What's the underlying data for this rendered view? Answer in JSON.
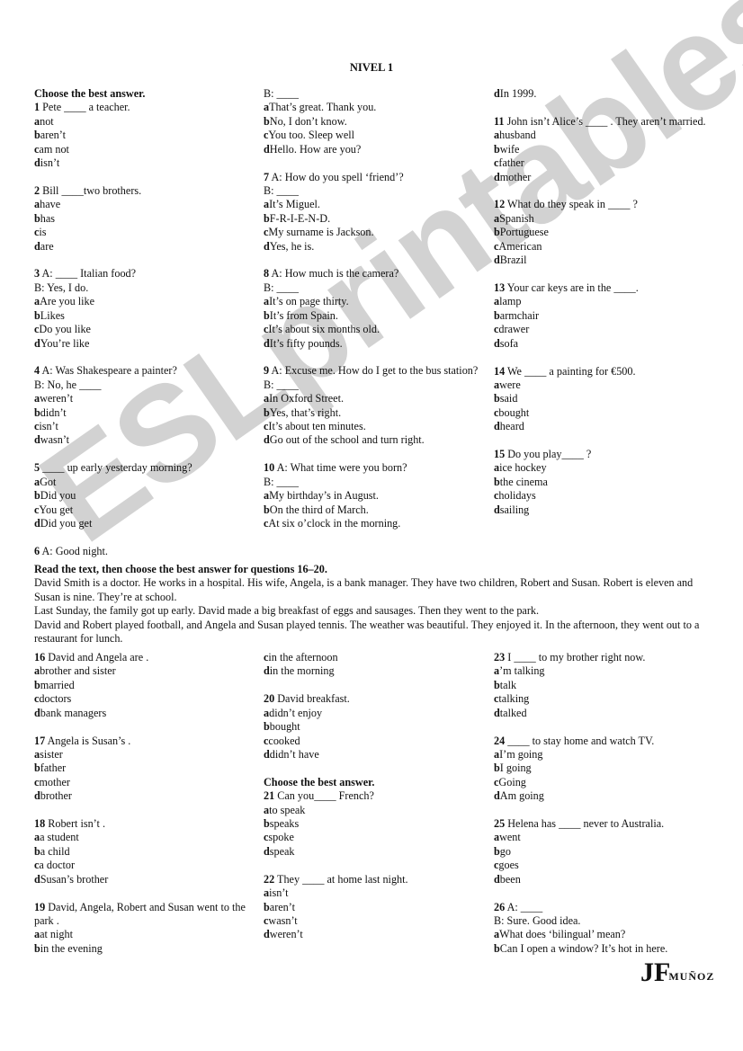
{
  "watermark": "ESLprintables.com",
  "title": "NIVEL 1",
  "section1_heading": "Choose the best answer.",
  "columns_top": [
    [
      {
        "n": "1",
        "stem": "Pete ____ a teacher.",
        "extra": [],
        "options": [
          [
            "a",
            "not"
          ],
          [
            "b",
            "aren’t"
          ],
          [
            "c",
            "am not"
          ],
          [
            "d",
            "isn’t"
          ]
        ]
      },
      {
        "n": "2",
        "stem": "Bill ____two brothers.",
        "extra": [],
        "options": [
          [
            "a",
            "have"
          ],
          [
            "b",
            "has"
          ],
          [
            "c",
            "is"
          ],
          [
            "d",
            "are"
          ]
        ]
      },
      {
        "n": "3",
        "stem": "A: ____  Italian food?",
        "extra": [
          "B: Yes, I do."
        ],
        "options": [
          [
            "a",
            "Are you like"
          ],
          [
            "b",
            "Likes"
          ],
          [
            "c",
            "Do you like"
          ],
          [
            "d",
            "You’re like"
          ]
        ]
      },
      {
        "n": "4",
        "stem": "A: Was Shakespeare a painter?",
        "extra": [
          "B: No, he ____"
        ],
        "options": [
          [
            "a",
            "weren’t"
          ],
          [
            "b",
            "didn’t"
          ],
          [
            "c",
            "isn’t"
          ],
          [
            "d",
            "wasn’t"
          ]
        ]
      },
      {
        "n": "5",
        "stem": "____ up early yesterday morning?",
        "extra": [],
        "options": [
          [
            "a",
            "Got"
          ],
          [
            "b",
            "Did you"
          ],
          [
            "c",
            "You get"
          ],
          [
            "d",
            "Did you get"
          ]
        ]
      },
      {
        "n": "6",
        "stem": "A: Good night.",
        "extra": [],
        "options": []
      }
    ],
    [
      {
        "n": "",
        "stem": "",
        "extra": [
          "B: ____"
        ],
        "options": [
          [
            "a",
            "That’s great. Thank you."
          ],
          [
            "b",
            "No, I don’t know."
          ],
          [
            "c",
            "You too. Sleep well"
          ],
          [
            "d",
            "Hello. How are you?"
          ]
        ]
      },
      {
        "n": "7",
        "stem": "A: How do you spell ‘friend’?",
        "extra": [
          "B: ____"
        ],
        "options": [
          [
            "a",
            "It’s Miguel."
          ],
          [
            "b",
            "F-R-I-E-N-D."
          ],
          [
            "c",
            "My surname is Jackson."
          ],
          [
            "d",
            "Yes, he is."
          ]
        ]
      },
      {
        "n": "8",
        "stem": "A: How much is the camera?",
        "extra": [
          "B: ____"
        ],
        "options": [
          [
            "a",
            "It’s on page thirty."
          ],
          [
            "b",
            "It’s from Spain."
          ],
          [
            "c",
            "It’s about six months old."
          ],
          [
            "d",
            "It’s fifty pounds."
          ]
        ]
      },
      {
        "n": "9",
        "stem": "A: Excuse me. How do I get to the bus station?",
        "extra": [
          "B: ____"
        ],
        "options": [
          [
            "a",
            "In Oxford Street."
          ],
          [
            "b",
            "Yes, that’s right."
          ],
          [
            "c",
            "It’s about ten minutes."
          ],
          [
            "d",
            "Go out of the school and turn right."
          ]
        ]
      },
      {
        "n": "10",
        "stem": "A: What time were you born?",
        "extra": [
          "B: ____"
        ],
        "options": [
          [
            "a",
            "My birthday’s in August."
          ],
          [
            "b",
            "On the third of March."
          ],
          [
            "c",
            "At six o’clock in the morning."
          ]
        ]
      }
    ],
    [
      {
        "n": "",
        "stem": "",
        "extra": [],
        "options": [
          [
            "d",
            "In 1999."
          ]
        ]
      },
      {
        "n": "11",
        "stem": "John isn’t Alice’s ____ . They aren’t married.",
        "extra": [],
        "options": [
          [
            "a",
            "husband"
          ],
          [
            "b",
            "wife"
          ],
          [
            "c",
            "father"
          ],
          [
            "d",
            "mother"
          ]
        ]
      },
      {
        "n": "12",
        "stem": "What do they speak in ____ ?",
        "extra": [],
        "options": [
          [
            "a",
            "Spanish"
          ],
          [
            "b",
            "Portuguese"
          ],
          [
            "c",
            "American"
          ],
          [
            "d",
            "Brazil"
          ]
        ]
      },
      {
        "n": "13",
        "stem": "Your car keys are in the ____.",
        "extra": [],
        "options": [
          [
            "a",
            "lamp"
          ],
          [
            "b",
            "armchair"
          ],
          [
            "c",
            "drawer"
          ],
          [
            "d",
            "sofa"
          ]
        ]
      },
      {
        "n": "14",
        "stem": "We ____ a painting for €500.",
        "extra": [],
        "options": [
          [
            "a",
            "were"
          ],
          [
            "b",
            "said"
          ],
          [
            "c",
            "bought"
          ],
          [
            "d",
            "heard"
          ]
        ]
      },
      {
        "n": "15",
        "stem": "Do you play____ ?",
        "extra": [],
        "options": [
          [
            "a",
            "ice hockey"
          ],
          [
            "b",
            "the cinema"
          ],
          [
            "c",
            "holidays"
          ],
          [
            "d",
            "sailing"
          ]
        ]
      }
    ]
  ],
  "reading": {
    "heading": "Read the text, then choose the best answer for questions 16–20.",
    "paragraphs": [
      "David Smith is a doctor. He works in a hospital. His wife, Angela, is a bank manager. They have two children, Robert and Susan. Robert is eleven and Susan is nine. They’re at school.",
      "Last Sunday, the family got up early. David made a big breakfast of eggs and sausages. Then they went to the park.",
      "David and Robert played football, and Angela and Susan played tennis.  The weather was beautiful.  They enjoyed it.  In the afternoon, they went out to a restaurant for lunch."
    ]
  },
  "section2_heading": "Choose the best answer.",
  "columns_bottom": [
    [
      {
        "n": "16",
        "stem": "David and Angela are .",
        "extra": [],
        "options": [
          [
            "a",
            "brother and sister"
          ],
          [
            "b",
            "married"
          ],
          [
            "c",
            "doctors"
          ],
          [
            "d",
            "bank managers"
          ]
        ]
      },
      {
        "n": "17",
        "stem": "Angela is Susan’s .",
        "extra": [],
        "options": [
          [
            "a",
            "sister"
          ],
          [
            "b",
            "father"
          ],
          [
            "c",
            "mother"
          ],
          [
            "d",
            "brother"
          ]
        ]
      },
      {
        "n": "18",
        "stem": "Robert isn’t .",
        "extra": [],
        "options": [
          [
            "a",
            "a student"
          ],
          [
            "b",
            "a child"
          ],
          [
            "c",
            "a doctor"
          ],
          [
            "d",
            "Susan’s brother"
          ]
        ]
      },
      {
        "n": "19",
        "stem": "David, Angela, Robert and Susan went to the park .",
        "extra": [],
        "options": [
          [
            "a",
            "at night"
          ],
          [
            "b",
            "in the evening"
          ]
        ]
      }
    ],
    [
      {
        "n": "",
        "stem": "",
        "extra": [],
        "options": [
          [
            "c",
            "in the afternoon"
          ],
          [
            "d",
            "in the morning"
          ]
        ]
      },
      {
        "n": "20",
        "stem": "David breakfast.",
        "extra": [],
        "options": [
          [
            "a",
            "didn’t enjoy"
          ],
          [
            "b",
            "bought"
          ],
          [
            "c",
            "cooked"
          ],
          [
            "d",
            "didn’t have"
          ]
        ]
      },
      {
        "heading": "Choose the best answer.",
        "n": "21",
        "stem": "Can you____  French?",
        "extra": [],
        "options": [
          [
            "a",
            "to speak"
          ],
          [
            "b",
            "speaks"
          ],
          [
            "c",
            "spoke"
          ],
          [
            "d",
            "speak"
          ]
        ]
      },
      {
        "n": "22",
        "stem": "They ____  at home last night.",
        "extra": [],
        "options": [
          [
            "a",
            "isn’t"
          ],
          [
            "b",
            "aren’t"
          ],
          [
            "c",
            "wasn’t"
          ],
          [
            "d",
            "weren’t"
          ]
        ]
      }
    ],
    [
      {
        "n": "23",
        "stem": "I ____  to my brother right now.",
        "extra": [],
        "options": [
          [
            "a",
            "’m talking"
          ],
          [
            "b",
            "talk"
          ],
          [
            "c",
            "talking"
          ],
          [
            "d",
            "talked"
          ]
        ]
      },
      {
        "n": "24",
        "stem": "____ to stay home and watch TV.",
        "extra": [],
        "options": [
          [
            "a",
            "I’m going"
          ],
          [
            "b",
            "I going"
          ],
          [
            "c",
            "Going"
          ],
          [
            "d",
            "Am going"
          ]
        ]
      },
      {
        "n": "25",
        "stem": "Helena has  ____ never to Australia.",
        "extra": [],
        "options": [
          [
            "a",
            "went"
          ],
          [
            "b",
            "go"
          ],
          [
            "c",
            "goes"
          ],
          [
            "d",
            "been"
          ]
        ]
      },
      {
        "n": "26",
        "stem": "A: ____",
        "extra": [
          "B: Sure. Good idea."
        ],
        "options": [
          [
            "a",
            "What does ‘bilingual’ mean?"
          ],
          [
            "b",
            "Can I open a window? It’s hot in here."
          ]
        ]
      }
    ]
  ],
  "logo": {
    "monogram": "JF",
    "name": "MUÑOZ"
  }
}
